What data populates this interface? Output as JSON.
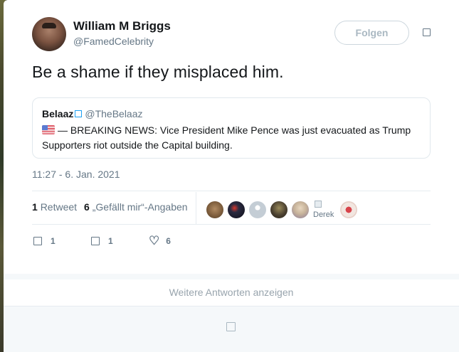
{
  "tweet": {
    "author_name": "William M Briggs",
    "author_handle": "@FamedCelebrity",
    "follow_label": "Folgen",
    "text": "Be a shame if they misplaced him.",
    "timestamp": "11:27 - 6. Jan. 2021"
  },
  "quote": {
    "name": "Belaaz",
    "handle": "@TheBelaaz",
    "body": "— BREAKING NEWS: Vice President Mike Pence was just evacuated as Trump Supporters riot outside the Capital building."
  },
  "stats": {
    "retweet_count": "1",
    "retweet_label": "Retweet",
    "like_count": "6",
    "like_label": "„Gefällt mir“-Angaben"
  },
  "likers": {
    "broken_label": "Derek",
    "avatar_colors": [
      "#8a6a4a",
      "#1a1a2a",
      "#c4cdd5",
      "#4a4030",
      "#c7b39a",
      "#e8d0c8"
    ]
  },
  "actions": {
    "reply_count": "1",
    "retweet_count": "1",
    "like_count": "6"
  },
  "more_replies_label": "Weitere Antworten anzeigen",
  "colors": {
    "text": "#14171a",
    "muted": "#657786",
    "accent": "#1da1f2",
    "border": "#e6ecf0"
  }
}
